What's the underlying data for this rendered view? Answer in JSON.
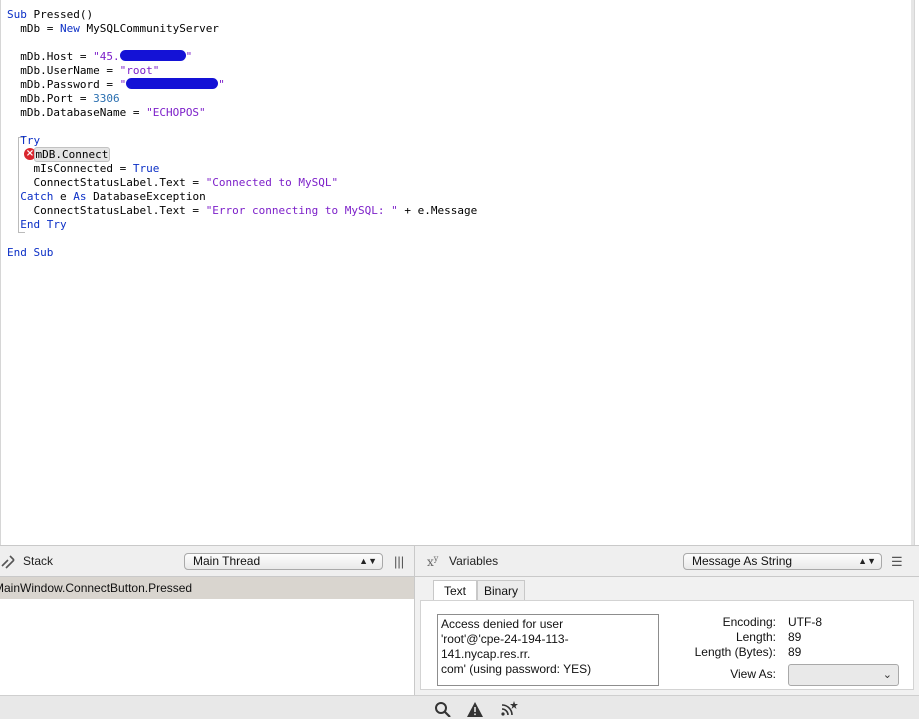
{
  "code": {
    "line1_kw": "Sub",
    "line1_rest": " Pressed()",
    "line2_a": "  mDb = ",
    "line2_kw": "New",
    "line2_b": " MySQLCommunityServer",
    "host_a": "  mDb.Host = ",
    "host_str": "\"45.",
    "host_end": "\"",
    "username_a": "  mDb.UserName = ",
    "username_str": "\"root\"",
    "password_a": "  mDb.Password = ",
    "password_str": "\"",
    "password_end": "\"",
    "port_a": "  mDb.Port = ",
    "port_num": "3306",
    "dbname_a": "  mDb.DatabaseName = ",
    "dbname_str": "\"ECHOPOS\"",
    "try_kw": "  Try",
    "connect": "mDB.Connect",
    "isconnected_a": "    mIsConnected = ",
    "isconnected_kw": "True",
    "label1_a": "    ConnectStatusLabel.Text = ",
    "label1_str": "\"Connected to MySQL\"",
    "catch_kw1": "  Catch",
    "catch_mid": " e ",
    "catch_kw2": "As",
    "catch_rest": " DatabaseException",
    "label2_a": "    ConnectStatusLabel.Text = ",
    "label2_str": "\"Error connecting to MySQL: \"",
    "label2_b": " + e.Message",
    "endtry_kw": "  End Try",
    "endsub_kw": "End Sub"
  },
  "stack": {
    "title": "Stack",
    "thread_select": "Main Thread",
    "frames": [
      "MainWindow.ConnectButton.Pressed"
    ]
  },
  "variables": {
    "title": "Variables",
    "xy_glyph": "x",
    "xy_sup": "y",
    "mode_select": "Message As String",
    "tabs": [
      "Text",
      "Binary"
    ],
    "value_line1": "Access denied for user",
    "value_line2": "'root'@'cpe-24-194-113-141.nycap.res.rr.",
    "value_line3": "com' (using password: YES)",
    "encoding_label": "Encoding:",
    "encoding_value": "UTF-8",
    "length_label": "Length:",
    "length_value": "89",
    "length_bytes_label": "Length (Bytes):",
    "length_bytes_value": "89",
    "view_as_label": "View As:",
    "view_as_value": ""
  },
  "colors": {
    "keyword": "#0b2fc6",
    "string": "#7c1fc9",
    "number": "#2a6fb0",
    "error": "#d9262e",
    "redaction": "#1412d6"
  },
  "statusbar_icons": [
    "search-icon",
    "warning-icon",
    "build-status-icon"
  ]
}
